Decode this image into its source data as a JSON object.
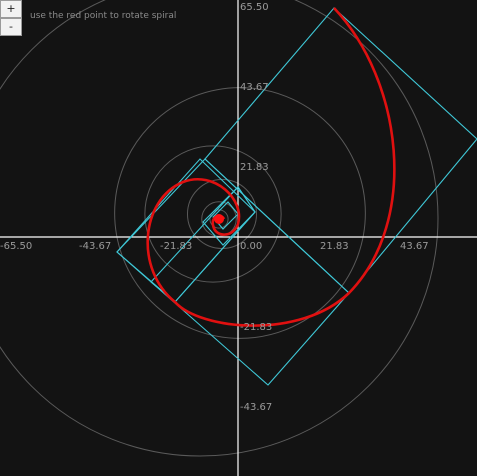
{
  "controls": {
    "zoom_in_label": "+",
    "zoom_out_label": "-"
  },
  "hint_text": "use the red point to rotate spiral",
  "axes": {
    "x_ticks": [
      "-65.50",
      "-43.67",
      "-21.83",
      "0.00",
      "21.83",
      "43.67"
    ],
    "y_ticks": [
      "65.50",
      "43.67",
      "21.83",
      "-21.83",
      "-43.67"
    ]
  },
  "colors": {
    "background": "#131313",
    "axis": "#ffffff",
    "circles": "#5a5a5a",
    "squares": "#3fc7d6",
    "spiral": "#e01010",
    "handle": "#ff1010"
  },
  "spiral": {
    "rotation_deg": 45,
    "circle_radii": [
      2.5,
      4.75,
      9.5,
      18.75,
      34.5,
      65.5
    ]
  }
}
